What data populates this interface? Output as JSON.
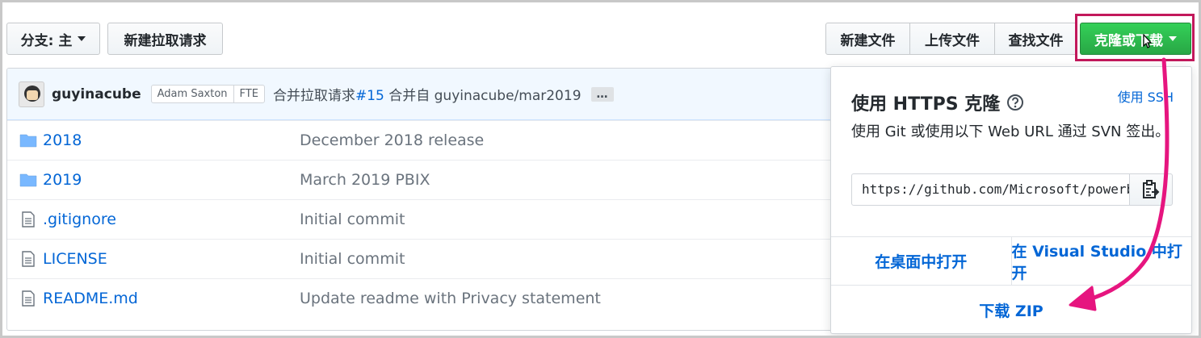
{
  "toolbar": {
    "branch_label": "分支: 主",
    "new_pr_label": "新建拉取请求",
    "new_file_label": "新建文件",
    "upload_label": "上传文件",
    "find_file_label": "查找文件",
    "clone_label": "克隆或下载"
  },
  "commit": {
    "author": "guyinacube",
    "coauthor": "Adam Saxton",
    "coauthor_tag": "FTE",
    "message_prefix": "合并拉取请求",
    "pr_link": "#15",
    "message_suffix": "合并自 guyinacube/mar2019",
    "ellipsis": "…"
  },
  "files": [
    {
      "icon": "folder-icon",
      "name": "2018",
      "message": "December 2018 release"
    },
    {
      "icon": "folder-icon",
      "name": "2019",
      "message": "March 2019 PBIX"
    },
    {
      "icon": "file-icon",
      "name": ".gitignore",
      "message": "Initial commit"
    },
    {
      "icon": "file-icon",
      "name": "LICENSE",
      "message": "Initial commit"
    },
    {
      "icon": "file-icon",
      "name": "README.md",
      "message": "Update readme with Privacy statement"
    }
  ],
  "clone_popover": {
    "title": "使用 HTTPS 克隆",
    "ssh_link": "使用 SSH",
    "description": "使用 Git 或使用以下 Web URL 通过 SVN 签出。",
    "url": "https://github.com/Microsoft/powerbi-desktop-samples.git",
    "open_desktop": "在桌面中打开",
    "open_vs": "在 Visual Studio 中打开",
    "download_zip": "下载 ZIP"
  },
  "colors": {
    "accent_link": "#0366d6",
    "clone_button": "#28a745",
    "highlight": "#c2185b",
    "annotation_arrow": "#e6157f"
  }
}
